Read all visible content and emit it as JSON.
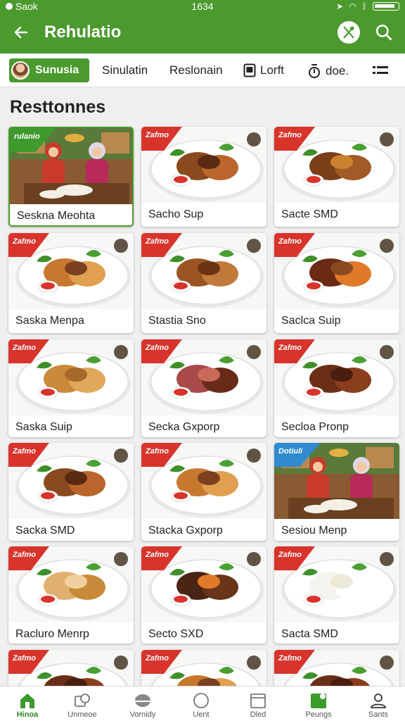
{
  "status_bar": {
    "carrier": "Saok",
    "time": "1634"
  },
  "app_bar": {
    "title": "Rehulatio"
  },
  "tabs": [
    {
      "label": "Sunusia",
      "active": true
    },
    {
      "label": "Sinulatin"
    },
    {
      "label": "Reslonain"
    },
    {
      "label": "Lorft",
      "icon": "document-icon"
    },
    {
      "label": "doe.",
      "icon": "timer-icon"
    }
  ],
  "section": {
    "title": "Resttonnes"
  },
  "ribbon_text": {
    "default": "Zafmo",
    "first": "rulanio",
    "blue": "Dotiuli"
  },
  "cards": [
    {
      "name": "Seskna Meohta",
      "ribbon": "green",
      "kind": "people"
    },
    {
      "name": "Sacho Sup",
      "ribbon": "red",
      "kind": "chicken"
    },
    {
      "name": "Sacte SMD",
      "ribbon": "red",
      "kind": "chicken2"
    },
    {
      "name": "Saska Menpa",
      "ribbon": "red",
      "kind": "noodles"
    },
    {
      "name": "Stastia Sno",
      "ribbon": "red",
      "kind": "meat"
    },
    {
      "name": "Saclca Suip",
      "ribbon": "red",
      "kind": "veg"
    },
    {
      "name": "Saska Suip",
      "ribbon": "red",
      "kind": "fried"
    },
    {
      "name": "Secka Gxporp",
      "ribbon": "red",
      "kind": "steak"
    },
    {
      "name": "Secloa Pronp",
      "ribbon": "red",
      "kind": "beef"
    },
    {
      "name": "Sacka SMD",
      "ribbon": "red",
      "kind": "chicken"
    },
    {
      "name": "Stacka Gxporp",
      "ribbon": "red",
      "kind": "noodles"
    },
    {
      "name": "Sesiou Menp",
      "ribbon": "blue",
      "kind": "people"
    },
    {
      "name": "Racluro Menrp",
      "ribbon": "red",
      "kind": "bread"
    },
    {
      "name": "Secto SXD",
      "ribbon": "red",
      "kind": "steak2"
    },
    {
      "name": "Sacta SMD",
      "ribbon": "red",
      "kind": "rice"
    },
    {
      "name": "",
      "ribbon": "red",
      "kind": "beef"
    },
    {
      "name": "",
      "ribbon": "red",
      "kind": "noodles"
    },
    {
      "name": "",
      "ribbon": "red",
      "kind": "beef"
    }
  ],
  "bottom_nav": [
    {
      "label": "Hinoa",
      "icon": "home-icon",
      "active": true
    },
    {
      "label": "Unmeoe",
      "icon": "gallery-icon"
    },
    {
      "label": "Vornidy",
      "icon": "dome-icon"
    },
    {
      "label": "Uent",
      "icon": "circle-icon"
    },
    {
      "label": "Dled",
      "icon": "calendar-icon"
    },
    {
      "label": "Peungs",
      "icon": "bookmark-icon"
    },
    {
      "label": "Sants",
      "icon": "profile-icon"
    }
  ],
  "colors": {
    "brand_green": "#4a9a2e",
    "ribbon_red": "#d8342c",
    "ribbon_blue": "#2f8ad0"
  }
}
